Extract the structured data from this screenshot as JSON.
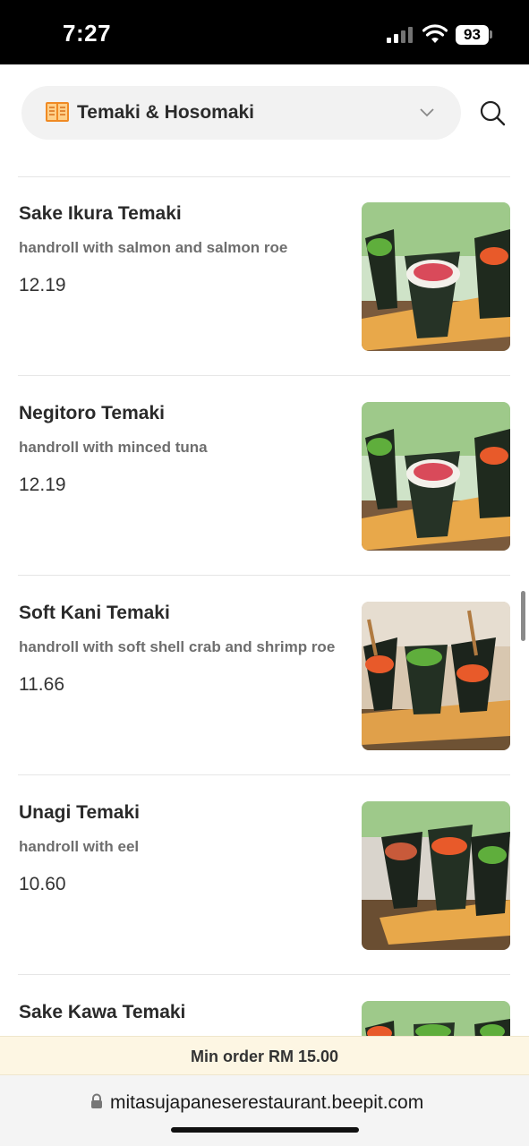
{
  "status_bar": {
    "time": "7:27",
    "battery": "93",
    "icons": [
      "signal-icon",
      "wifi-icon",
      "battery-icon"
    ]
  },
  "header": {
    "category_icon": "book-icon",
    "category_label": "Temaki & Hosomaki",
    "dropdown_icon": "chevron-down-icon",
    "search_icon": "search-icon"
  },
  "menu": {
    "items": [
      {
        "name": "Sake Ikura Temaki",
        "description": "handroll with salmon and salmon roe",
        "price": "12.19",
        "photo": "temaki-photo-1"
      },
      {
        "name": "Negitoro Temaki",
        "description": "handroll with minced tuna",
        "price": "12.19",
        "photo": "temaki-photo-1"
      },
      {
        "name": "Soft Kani Temaki",
        "description": "handroll with soft shell crab and shrimp roe",
        "price": "11.66",
        "photo": "temaki-photo-2"
      },
      {
        "name": "Unagi Temaki",
        "description": "handroll with eel",
        "price": "10.60",
        "photo": "temaki-photo-3"
      },
      {
        "name": "Sake Kawa Temaki",
        "description": "",
        "price": "",
        "photo": "temaki-photo-1"
      }
    ]
  },
  "cart_bar": {
    "min_order": "Min order RM 15.00"
  },
  "browser": {
    "url": "mitasujapaneserestaurant.beepit.com",
    "lock_icon": "lock-icon"
  },
  "colors": {
    "status_bar_bg": "#000000",
    "pill_bg": "#f2f2f2",
    "min_order_bg": "#fdf6e3",
    "name_text": "#2a2a2a",
    "desc_text": "#6e6e6e"
  }
}
